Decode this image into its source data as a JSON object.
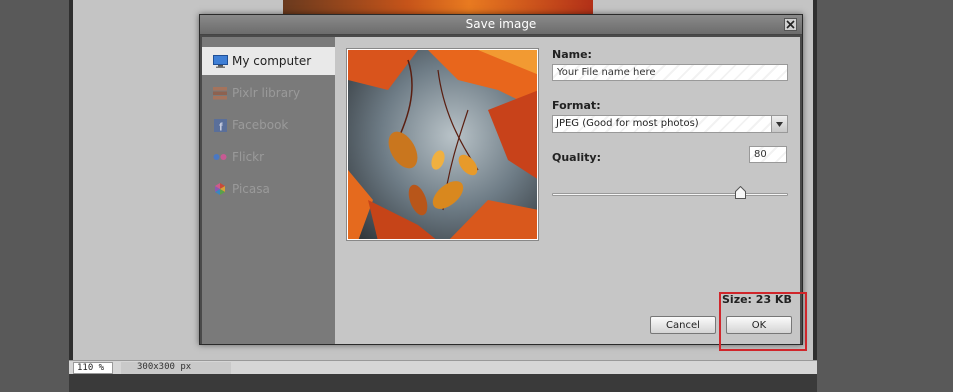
{
  "dialog": {
    "title": "Save image"
  },
  "sidebar": {
    "items": [
      {
        "label": "My computer",
        "icon": "monitor-icon",
        "active": true
      },
      {
        "label": "Pixlr library",
        "icon": "library-icon",
        "active": false
      },
      {
        "label": "Facebook",
        "icon": "facebook-icon",
        "active": false
      },
      {
        "label": "Flickr",
        "icon": "flickr-icon",
        "active": false
      },
      {
        "label": "Picasa",
        "icon": "picasa-icon",
        "active": false
      }
    ]
  },
  "form": {
    "name_label": "Name:",
    "name_value": "Your File name here",
    "format_label": "Format:",
    "format_value": "JPEG (Good for most photos)",
    "quality_label": "Quality:",
    "quality_value": "80",
    "quality_fraction": 0.8
  },
  "size": {
    "label": "Size: 23 KB"
  },
  "buttons": {
    "cancel": "Cancel",
    "ok": "OK"
  },
  "statusbar": {
    "zoom": "110 %",
    "dimensions": "300x300 px"
  },
  "colors": {
    "accent_highlight": "#d0262b",
    "facebook": "#3b5998",
    "flickr_blue": "#0063dc",
    "flickr_pink": "#ff0084"
  }
}
